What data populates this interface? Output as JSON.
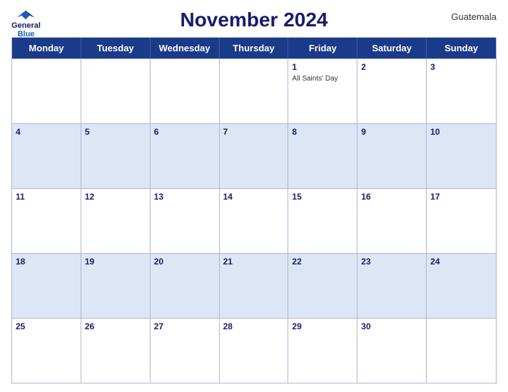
{
  "header": {
    "title": "November 2024",
    "country": "Guatemala"
  },
  "logo": {
    "line1": "General",
    "line2": "Blue"
  },
  "weekdays": [
    "Monday",
    "Tuesday",
    "Wednesday",
    "Thursday",
    "Friday",
    "Saturday",
    "Sunday"
  ],
  "weeks": [
    [
      {
        "day": "",
        "event": ""
      },
      {
        "day": "",
        "event": ""
      },
      {
        "day": "",
        "event": ""
      },
      {
        "day": "",
        "event": ""
      },
      {
        "day": "1",
        "event": "All Saints' Day"
      },
      {
        "day": "2",
        "event": ""
      },
      {
        "day": "3",
        "event": ""
      }
    ],
    [
      {
        "day": "4",
        "event": ""
      },
      {
        "day": "5",
        "event": ""
      },
      {
        "day": "6",
        "event": ""
      },
      {
        "day": "7",
        "event": ""
      },
      {
        "day": "8",
        "event": ""
      },
      {
        "day": "9",
        "event": ""
      },
      {
        "day": "10",
        "event": ""
      }
    ],
    [
      {
        "day": "11",
        "event": ""
      },
      {
        "day": "12",
        "event": ""
      },
      {
        "day": "13",
        "event": ""
      },
      {
        "day": "14",
        "event": ""
      },
      {
        "day": "15",
        "event": ""
      },
      {
        "day": "16",
        "event": ""
      },
      {
        "day": "17",
        "event": ""
      }
    ],
    [
      {
        "day": "18",
        "event": ""
      },
      {
        "day": "19",
        "event": ""
      },
      {
        "day": "20",
        "event": ""
      },
      {
        "day": "21",
        "event": ""
      },
      {
        "day": "22",
        "event": ""
      },
      {
        "day": "23",
        "event": ""
      },
      {
        "day": "24",
        "event": ""
      }
    ],
    [
      {
        "day": "25",
        "event": ""
      },
      {
        "day": "26",
        "event": ""
      },
      {
        "day": "27",
        "event": ""
      },
      {
        "day": "28",
        "event": ""
      },
      {
        "day": "29",
        "event": ""
      },
      {
        "day": "30",
        "event": ""
      },
      {
        "day": "",
        "event": ""
      }
    ]
  ]
}
